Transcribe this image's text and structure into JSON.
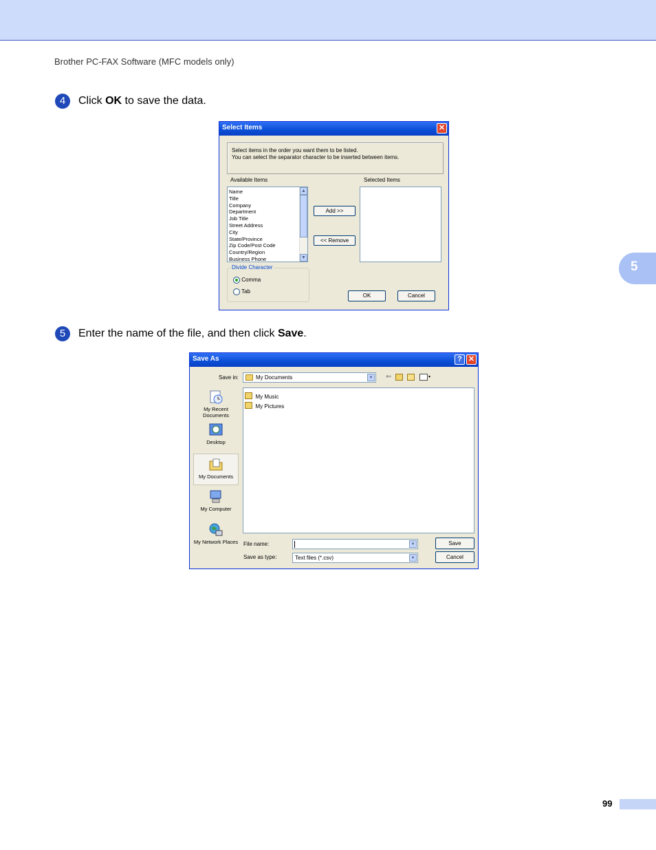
{
  "page": {
    "running_head": "Brother PC-FAX Software (MFC models only)",
    "chapter_tab": "5",
    "page_number": "99"
  },
  "step4": {
    "number": "4",
    "text_before": "Click ",
    "bold": "OK",
    "text_after": " to save the data."
  },
  "select_items": {
    "title": "Select Items",
    "close_glyph": "✕",
    "instruction_line1": "Select items in the order you want them to be listed.",
    "instruction_line2": "You can select the separator character to be inserted between items.",
    "available_label": "Available Items",
    "selected_label": "Selected Items",
    "available_items": [
      "Name",
      "Title",
      "Company",
      "Department",
      "Job Title",
      "Street Address",
      "City",
      "State/Province",
      "Zip Code/Post Code",
      "Country/Region",
      "Business Phone"
    ],
    "add_button": "Add >>",
    "remove_button": "<< Remove",
    "divide_group": "Divide Character",
    "comma_option": "Comma",
    "tab_option": "Tab",
    "ok_button": "OK",
    "cancel_button": "Cancel"
  },
  "step5": {
    "number": "5",
    "text_before": "Enter the name of the file, and then click ",
    "bold": "Save",
    "text_after": "."
  },
  "save_as": {
    "title": "Save As",
    "help_glyph": "?",
    "close_glyph": "✕",
    "save_in_label": "Save in:",
    "save_in_value": "My Documents",
    "places": [
      {
        "label": "My Recent Documents",
        "icon": "recent-documents-icon"
      },
      {
        "label": "Desktop",
        "icon": "desktop-icon"
      },
      {
        "label": "My Documents",
        "icon": "my-documents-icon"
      },
      {
        "label": "My Computer",
        "icon": "my-computer-icon"
      },
      {
        "label": "My Network Places",
        "icon": "network-places-icon"
      }
    ],
    "files": [
      "My Music",
      "My Pictures"
    ],
    "file_name_label": "File name:",
    "file_name_value": "",
    "save_as_type_label": "Save as type:",
    "save_as_type_value": "Text files (*.csv)",
    "save_button": "Save",
    "cancel_button": "Cancel"
  }
}
